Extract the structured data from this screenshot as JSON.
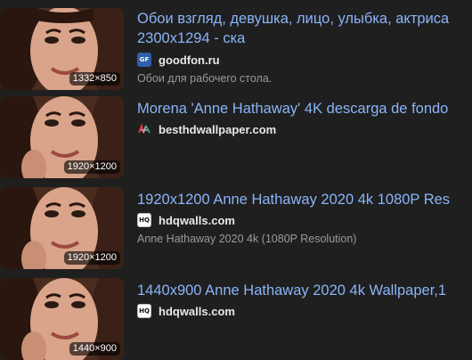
{
  "results": [
    {
      "title": "Обои взгляд, девушка, лицо, улыбка, актриса 2300x1294 - ска",
      "resolution": "1332×850",
      "source": "goodfon.ru",
      "favicon_icon": "goodfon-favicon",
      "favicon_text": "GF",
      "description": "Обои для рабочего стола."
    },
    {
      "title": "Morena 'Anne Hathaway' 4K descarga de fondo",
      "resolution": "1920×1200",
      "source": "besthdwallpaper.com",
      "favicon_icon": "besthdwallpaper-favicon",
      "description": ""
    },
    {
      "title": "1920x1200 Anne Hathaway 2020 4k 1080P Res",
      "resolution": "1920×1200",
      "source": "hdqwalls.com",
      "favicon_icon": "hdqwalls-favicon",
      "favicon_text": "HQ",
      "description": "Anne Hathaway 2020 4k (1080P Resolution)"
    },
    {
      "title": "1440x900 Anne Hathaway 2020 4k Wallpaper,1",
      "resolution": "1440×900",
      "source": "hdqwalls.com",
      "favicon_icon": "hdqwalls-favicon",
      "favicon_text": "HQ",
      "description": ""
    }
  ],
  "colors": {
    "background": "#1f1f1f",
    "title_link": "#8ab4f8",
    "source_text": "#e8e8e8",
    "description_text": "#9a9a9a"
  }
}
